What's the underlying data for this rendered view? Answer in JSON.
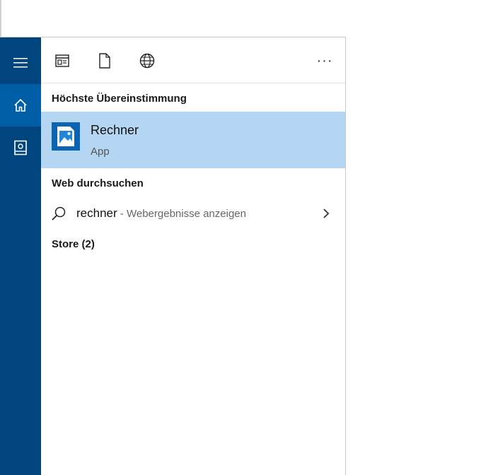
{
  "toolbar": {
    "apps_icon": "apps-filter-icon",
    "docs_icon": "documents-filter-icon",
    "web_icon": "web-filter-icon",
    "more_label": "···"
  },
  "rail": {
    "menu_icon": "hamburger-icon",
    "home_icon": "home-icon",
    "notebook_icon": "notebook-icon"
  },
  "best_match": {
    "heading": "Höchste Übereinstimmung",
    "title": "Rechner",
    "subtitle": "App",
    "icon": "calculator-app-icon"
  },
  "web": {
    "heading": "Web durchsuchen",
    "query": "rechner",
    "hint": " - Webergebnisse anzeigen"
  },
  "store": {
    "heading": "Store (2)"
  },
  "colors": {
    "rail": "#00457d",
    "rail_active": "#005ea6",
    "selection": "#b5d6f2",
    "app_tile": "#0a64b4"
  }
}
